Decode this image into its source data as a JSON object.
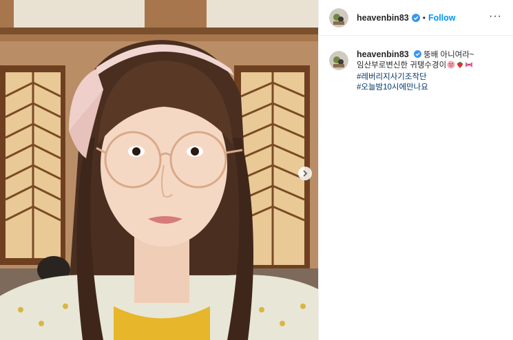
{
  "post": {
    "username": "heavenbin83",
    "follow_label": "Follow",
    "dot": "•",
    "more_label": "···",
    "caption_first": "뚱배 아니여라~",
    "caption_second": "임산부로변신한 귀탱수경이",
    "hashtags": [
      "#레버리지사기조작단",
      "#오늘밤10시에만나요"
    ],
    "emojis": [
      "pig-face-icon",
      "strawberry-icon",
      "ribbon-icon"
    ]
  },
  "colors": {
    "accent": "#0095f6",
    "hashtag": "#00376b",
    "verified": "#3897f0"
  }
}
